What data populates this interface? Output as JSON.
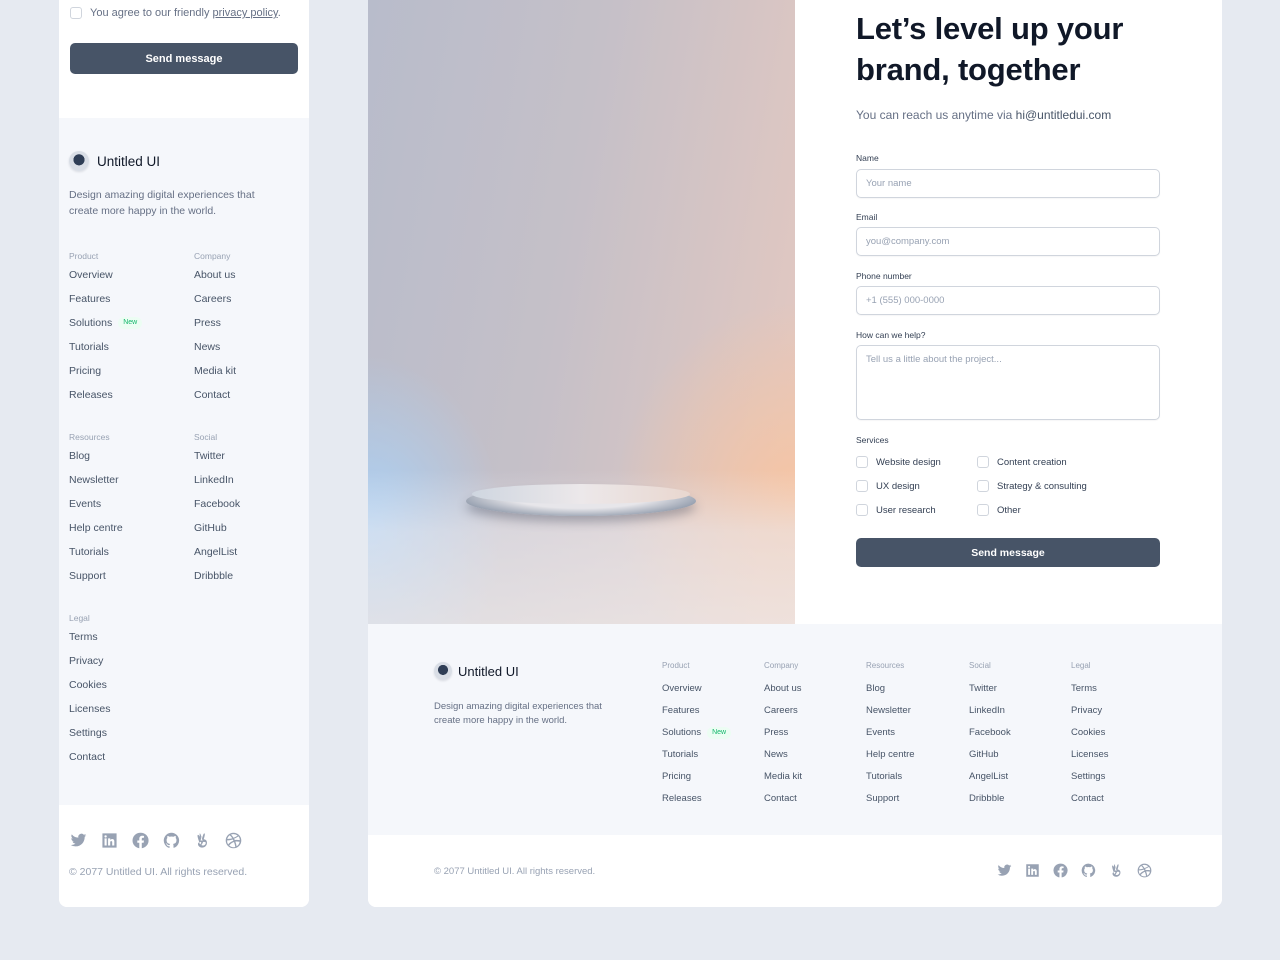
{
  "mobile": {
    "agree_text": "You agree to our friendly ",
    "agree_link": "privacy policy",
    "agree_end": ".",
    "send_label": "Send message",
    "brand": "Untitled UI",
    "description": "Design amazing digital experiences that create more happy in the world.",
    "columns": [
      {
        "heading": "Product",
        "links": [
          "Overview",
          "Features",
          "Solutions",
          "Tutorials",
          "Pricing",
          "Releases"
        ]
      },
      {
        "heading": "Company",
        "links": [
          "About us",
          "Careers",
          "Press",
          "News",
          "Media kit",
          "Contact"
        ]
      },
      {
        "heading": "Resources",
        "links": [
          "Blog",
          "Newsletter",
          "Events",
          "Help centre",
          "Tutorials",
          "Support"
        ]
      },
      {
        "heading": "Social",
        "links": [
          "Twitter",
          "LinkedIn",
          "Facebook",
          "GitHub",
          "AngelList",
          "Dribbble"
        ]
      },
      {
        "heading": "Legal",
        "links": [
          "Terms",
          "Privacy",
          "Cookies",
          "Licenses",
          "Settings",
          "Contact"
        ]
      }
    ],
    "new_badge": "New",
    "copyright": "© 2077 Untitled UI. All rights reserved."
  },
  "desktop": {
    "heading": "Let’s level up your brand, together",
    "subtitle_prefix": "You can reach us anytime via ",
    "subtitle_email": "hi@untitledui.com",
    "form": {
      "name_label": "Name",
      "name_placeholder": "Your name",
      "email_label": "Email",
      "email_placeholder": "you@company.com",
      "phone_label": "Phone number",
      "phone_placeholder": "+1 (555) 000-0000",
      "help_label": "How can we help?",
      "help_placeholder": "Tell us a little about the project...",
      "services_label": "Services",
      "services": [
        "Website design",
        "UX design",
        "User research",
        "Content creation",
        "Strategy & consulting",
        "Other"
      ],
      "send_label": "Send message"
    },
    "footer": {
      "brand": "Untitled UI",
      "description": "Design amazing digital experiences that create more happy in the world.",
      "columns": [
        {
          "heading": "Product",
          "links": [
            "Overview",
            "Features",
            "Solutions",
            "Tutorials",
            "Pricing",
            "Releases"
          ]
        },
        {
          "heading": "Company",
          "links": [
            "About us",
            "Careers",
            "Press",
            "News",
            "Media kit",
            "Contact"
          ]
        },
        {
          "heading": "Resources",
          "links": [
            "Blog",
            "Newsletter",
            "Events",
            "Help centre",
            "Tutorials",
            "Support"
          ]
        },
        {
          "heading": "Social",
          "links": [
            "Twitter",
            "LinkedIn",
            "Facebook",
            "GitHub",
            "AngelList",
            "Dribbble"
          ]
        },
        {
          "heading": "Legal",
          "links": [
            "Terms",
            "Privacy",
            "Cookies",
            "Licenses",
            "Settings",
            "Contact"
          ]
        }
      ],
      "new_badge": "New",
      "copyright": "© 2077 Untitled UI. All rights reserved."
    }
  },
  "social_icons": [
    "twitter-icon",
    "linkedin-icon",
    "facebook-icon",
    "github-icon",
    "angellist-icon",
    "dribbble-icon"
  ],
  "colors": {
    "page_bg": "#e6eaf1",
    "button": "#475467",
    "footer_bg": "#f5f7fb",
    "badge": "#12b76a"
  }
}
